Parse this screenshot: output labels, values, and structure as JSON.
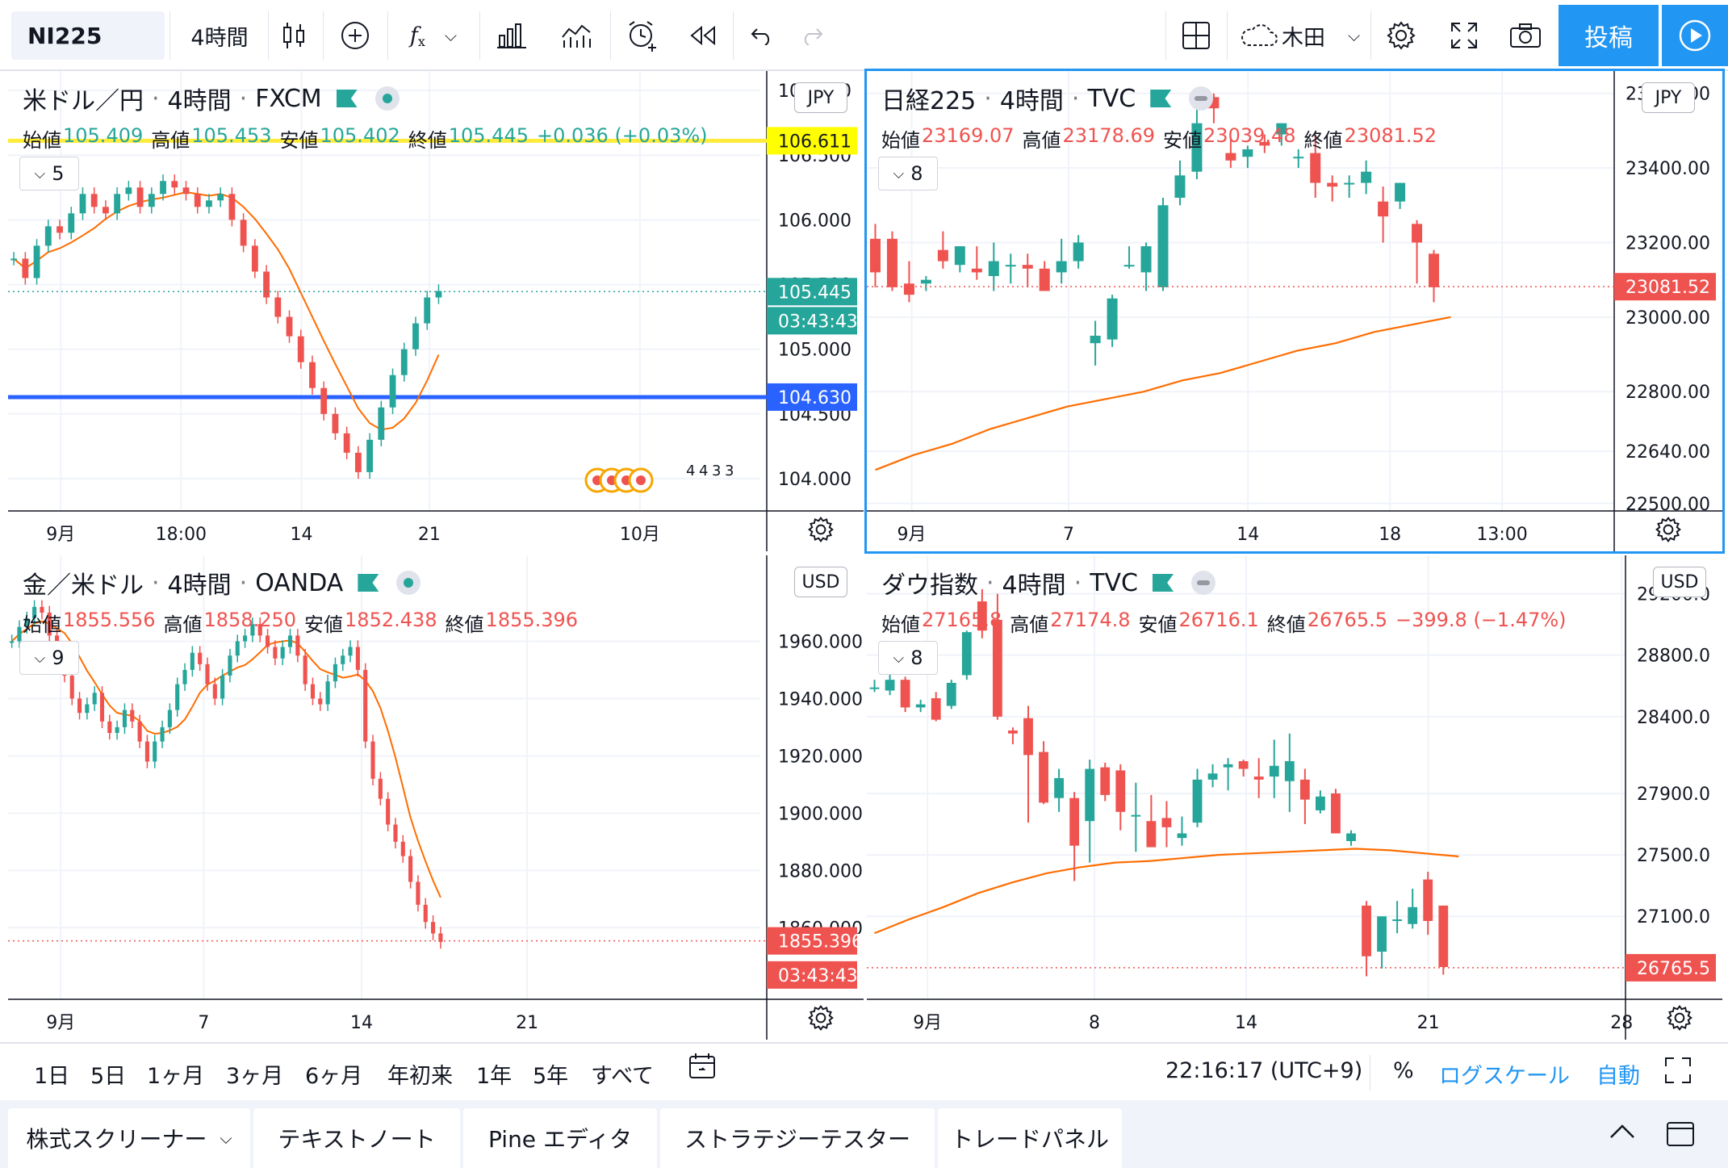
{
  "toolbar": {
    "symbol": "NI225",
    "interval": "4時間",
    "fx_label": "f",
    "layout_name": "木田",
    "post_label": "投稿"
  },
  "panes": [
    {
      "id": "usdjpy",
      "title": "米ドル／円",
      "interval": "4時間",
      "source": "FXCM",
      "status": "green",
      "open_label": "始値",
      "open": "105.409",
      "high_label": "高値",
      "high": "105.453",
      "low_label": "安値",
      "low": "105.402",
      "close_label": "終値",
      "close": "105.445",
      "change": "+0.036 (+0.03%)",
      "change_dir": "up",
      "indicators_count": "5",
      "currency": "JPY",
      "y_min": 103.75,
      "y_max": 107.15,
      "y_ticks": [
        "107.000",
        "106.500",
        "106.000",
        "105.500",
        "105.000",
        "104.500",
        "104.000"
      ],
      "y_tick_values": [
        107.0,
        106.5,
        106.0,
        105.5,
        105.0,
        104.5,
        104.0
      ],
      "x_ticks": [
        "9月",
        "18:00",
        "14",
        "21",
        "10月"
      ],
      "x_tick_pos": [
        0.07,
        0.23,
        0.39,
        0.56,
        0.84
      ],
      "price_labels": [
        {
          "text": "106.611",
          "value": 106.611,
          "bg": "#ffff00",
          "fg": "#131722"
        },
        {
          "text": "105.445",
          "value": 105.445,
          "bg": "#26a69a",
          "fg": "#ffffff"
        },
        {
          "text": "03:43:43",
          "value": 105.22,
          "bg": "#26a69a",
          "fg": "#ffffff"
        },
        {
          "text": "104.630",
          "value": 104.63,
          "bg": "#2962ff",
          "fg": "#ffffff"
        }
      ],
      "horizontal_lines": [
        {
          "value": 106.611,
          "color": "#ffeb3b"
        },
        {
          "value": 104.63,
          "color": "#2962ff"
        }
      ],
      "event_marks": [
        "4",
        "4",
        "3",
        "3"
      ],
      "chart_data": {
        "type": "line",
        "series": [
          {
            "name": "close",
            "values": [
              105.7,
              105.55,
              105.8,
              105.95,
              105.9,
              106.05,
              106.2,
              106.1,
              106.05,
              106.2,
              106.25,
              106.1,
              106.2,
              106.3,
              106.25,
              106.2,
              106.1,
              106.15,
              106.2,
              106.0,
              105.8,
              105.6,
              105.4,
              105.25,
              105.1,
              104.9,
              104.7,
              104.5,
              104.35,
              104.2,
              104.05,
              104.3,
              104.55,
              104.8,
              105.0,
              105.2,
              105.4,
              105.45
            ]
          }
        ]
      }
    },
    {
      "id": "ni225",
      "title": "日経225",
      "interval": "4時間",
      "source": "TVC",
      "status": "grey",
      "open_label": "始値",
      "open": "23169.07",
      "high_label": "高値",
      "high": "23178.69",
      "low_label": "安値",
      "low": "23039.48",
      "close_label": "終値",
      "close": "23081.52",
      "change": "",
      "change_dir": "down",
      "indicators_count": "8",
      "currency": "JPY",
      "y_min": 22480,
      "y_max": 23660,
      "y_ticks": [
        "23600.00",
        "23400.00",
        "23200.00",
        "23000.00",
        "22800.00",
        "22640.00",
        "22500.00"
      ],
      "y_tick_values": [
        23600,
        23400,
        23200,
        23000,
        22800,
        22640,
        22500
      ],
      "x_ticks": [
        "9月",
        "7",
        "14",
        "18",
        "13:00"
      ],
      "x_tick_pos": [
        0.06,
        0.27,
        0.51,
        0.7,
        0.85
      ],
      "price_labels": [
        {
          "text": "23081.52",
          "value": 23081.52,
          "bg": "#ef5350",
          "fg": "#ffffff"
        }
      ],
      "chart_data": {
        "type": "bar",
        "candles": [
          [
            23210,
            23250,
            23080,
            23120
          ],
          [
            23210,
            23230,
            23070,
            23080
          ],
          [
            23090,
            23150,
            23040,
            23060
          ],
          [
            23090,
            23110,
            23070,
            23100
          ],
          [
            23180,
            23230,
            23130,
            23150
          ],
          [
            23140,
            23190,
            23120,
            23190
          ],
          [
            23130,
            23190,
            23100,
            23120
          ],
          [
            23110,
            23200,
            23070,
            23150
          ],
          [
            23140,
            23170,
            23090,
            23140
          ],
          [
            23140,
            23170,
            23080,
            23130
          ],
          [
            23130,
            23150,
            23070,
            23070
          ],
          [
            23120,
            23210,
            23090,
            23150
          ],
          [
            23150,
            23220,
            23130,
            23200
          ],
          [
            22930,
            22990,
            22870,
            22950
          ],
          [
            22940,
            23060,
            22920,
            23050
          ],
          [
            23140,
            23190,
            23130,
            23140
          ],
          [
            23120,
            23200,
            23070,
            23190
          ],
          [
            23080,
            23320,
            23070,
            23300
          ],
          [
            23320,
            23420,
            23300,
            23380
          ],
          [
            23390,
            23580,
            23370,
            23520
          ],
          [
            23590,
            23600,
            23520,
            23560
          ],
          [
            23440,
            23480,
            23400,
            23420
          ],
          [
            23430,
            23460,
            23400,
            23450
          ],
          [
            23470,
            23490,
            23440,
            23460
          ],
          [
            23490,
            23520,
            23460,
            23520
          ],
          [
            23430,
            23450,
            23400,
            23430
          ],
          [
            23440,
            23490,
            23320,
            23360
          ],
          [
            23360,
            23380,
            23310,
            23350
          ],
          [
            23360,
            23380,
            23320,
            23360
          ],
          [
            23360,
            23420,
            23330,
            23390
          ],
          [
            23310,
            23350,
            23200,
            23270
          ],
          [
            23310,
            23360,
            23290,
            23360
          ],
          [
            23250,
            23260,
            23090,
            23200
          ],
          [
            23170,
            23180,
            23040,
            23080
          ]
        ],
        "ma": [
          22590,
          22630,
          22660,
          22700,
          22730,
          22760,
          22780,
          22800,
          22830,
          22850,
          22880,
          22910,
          22930,
          22960,
          22980,
          23000
        ]
      }
    },
    {
      "id": "xauusd",
      "title": "金／米ドル",
      "interval": "4時間",
      "source": "OANDA",
      "status": "green",
      "open_label": "始値",
      "open": "1855.556",
      "high_label": "高値",
      "high": "1858.250",
      "low_label": "安値",
      "low": "1852.438",
      "close_label": "終値",
      "close": "1855.396",
      "change": "",
      "change_dir": "down",
      "indicators_count": "9",
      "currency": "USD",
      "y_min": 1835,
      "y_max": 1990,
      "y_ticks": [
        "1960.000",
        "1940.000",
        "1920.000",
        "1900.000",
        "1880.000",
        "1860.000"
      ],
      "y_tick_values": [
        1960,
        1940,
        1920,
        1900,
        1880,
        1860
      ],
      "x_ticks": [
        "9月",
        "7",
        "14",
        "21"
      ],
      "x_tick_pos": [
        0.07,
        0.26,
        0.47,
        0.69
      ],
      "price_labels": [
        {
          "text": "1855.396",
          "value": 1855.396,
          "bg": "#ef5350",
          "fg": "#ffffff"
        },
        {
          "text": "03:43:43",
          "value": 1843.5,
          "bg": "#ef5350",
          "fg": "#ffffff"
        }
      ],
      "chart_data": {
        "type": "line",
        "series": [
          {
            "name": "close",
            "values": [
              1960,
              1965,
              1968,
              1972,
              1970,
              1962,
              1955,
              1948,
              1940,
              1935,
              1938,
              1942,
              1932,
              1928,
              1930,
              1936,
              1932,
              1925,
              1918,
              1925,
              1930,
              1936,
              1945,
              1950,
              1956,
              1952,
              1945,
              1940,
              1948,
              1955,
              1960,
              1962,
              1966,
              1962,
              1958,
              1954,
              1958,
              1962,
              1955,
              1945,
              1940,
              1938,
              1946,
              1952,
              1955,
              1958,
              1950,
              1925,
              1912,
              1905,
              1896,
              1890,
              1885,
              1876,
              1868,
              1862,
              1858,
              1855
            ]
          }
        ]
      }
    },
    {
      "id": "dji",
      "title": "ダウ指数",
      "interval": "4時間",
      "source": "TVC",
      "status": "grey",
      "open_label": "始値",
      "open": "27165.8",
      "high_label": "高値",
      "high": "27174.8",
      "low_label": "安値",
      "low": "26716.1",
      "close_label": "終値",
      "close": "26765.5",
      "change": "−399.8 (−1.47%)",
      "change_dir": "down",
      "indicators_count": "8",
      "currency": "USD",
      "y_min": 26560,
      "y_max": 29450,
      "y_ticks": [
        "29200.0",
        "28800.0",
        "28400.0",
        "27900.0",
        "27500.0",
        "27100.0"
      ],
      "y_tick_values": [
        29200,
        28800,
        28400,
        27900,
        27500,
        27100
      ],
      "x_ticks": [
        "9月",
        "8",
        "14",
        "21",
        "28"
      ],
      "x_tick_pos": [
        0.08,
        0.3,
        0.5,
        0.74,
        0.995
      ],
      "price_labels": [
        {
          "text": "26765.5",
          "value": 26765.5,
          "bg": "#ef5350",
          "fg": "#ffffff"
        }
      ],
      "chart_data": {
        "type": "bar",
        "candles": [
          [
            28590,
            28640,
            28560,
            28590
          ],
          [
            28570,
            28680,
            28540,
            28640
          ],
          [
            28640,
            28660,
            28430,
            28460
          ],
          [
            28460,
            28510,
            28430,
            28480
          ],
          [
            28520,
            28560,
            28370,
            28380
          ],
          [
            28470,
            28640,
            28450,
            28620
          ],
          [
            28670,
            28960,
            28640,
            28950
          ],
          [
            29150,
            29230,
            28910,
            28960
          ],
          [
            29030,
            29200,
            28380,
            28400
          ],
          [
            28310,
            28330,
            28220,
            28290
          ],
          [
            28390,
            28470,
            27710,
            28150
          ],
          [
            28170,
            28240,
            27830,
            27840
          ],
          [
            27870,
            28060,
            27780,
            28000
          ],
          [
            27870,
            27910,
            27330,
            27560
          ],
          [
            27720,
            28120,
            27450,
            28060
          ],
          [
            28070,
            28100,
            27850,
            27890
          ],
          [
            28050,
            28090,
            27660,
            27780
          ],
          [
            27760,
            27970,
            27520,
            27760
          ],
          [
            27720,
            27890,
            27570,
            27550
          ],
          [
            27740,
            27850,
            27550,
            27680
          ],
          [
            27610,
            27750,
            27560,
            27640
          ],
          [
            27710,
            28060,
            27680,
            27990
          ],
          [
            27990,
            28090,
            27940,
            28030
          ],
          [
            28070,
            28130,
            27920,
            28090
          ],
          [
            28110,
            28120,
            28010,
            28060
          ],
          [
            28010,
            28130,
            27870,
            27990
          ],
          [
            28010,
            28250,
            27870,
            28080
          ],
          [
            27980,
            28290,
            27780,
            28110
          ],
          [
            27990,
            28060,
            27700,
            27860
          ],
          [
            27790,
            27920,
            27770,
            27880
          ],
          [
            27900,
            27930,
            27720,
            27640
          ],
          [
            27590,
            27660,
            27560,
            27640
          ],
          [
            27170,
            27200,
            26710,
            26840
          ],
          [
            26870,
            26990,
            26760,
            27100
          ],
          [
            27070,
            27200,
            26990,
            27080
          ],
          [
            27050,
            27280,
            27020,
            27160
          ],
          [
            27340,
            27390,
            26980,
            27070
          ],
          [
            27170,
            27170,
            26720,
            26770
          ]
        ],
        "ma": [
          26990,
          27080,
          27160,
          27250,
          27320,
          27380,
          27420,
          27450,
          27460,
          27480,
          27500,
          27510,
          27520,
          27530,
          27540,
          27530,
          27510,
          27490
        ]
      }
    }
  ],
  "bottom_bar": {
    "ranges": [
      "1日",
      "5日",
      "1ヶ月",
      "3ヶ月",
      "6ヶ月",
      "年初来",
      "1年",
      "5年",
      "すべて"
    ],
    "time": "22:16:17 (UTC+9)",
    "percent": "%",
    "log_scale": "ログスケール",
    "auto": "自動"
  },
  "bottom_tabs": [
    "株式スクリーナー",
    "テキストノート",
    "Pine エディタ",
    "ストラテジーテスター",
    "トレードパネル"
  ],
  "colors": {
    "up": "#26a69a",
    "down": "#ef5350",
    "accent": "#2196f3",
    "grid": "#f0f3fa"
  }
}
